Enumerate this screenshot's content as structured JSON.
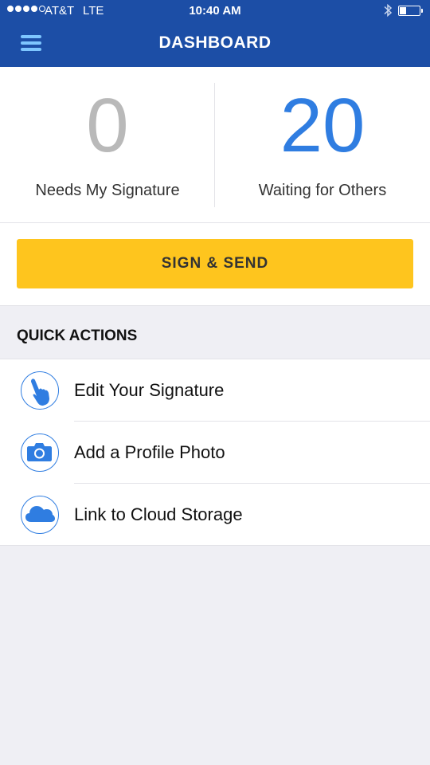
{
  "status": {
    "carrier": "AT&T",
    "network": "LTE",
    "time": "10:40 AM",
    "signal_bars": 4
  },
  "nav": {
    "title": "DASHBOARD"
  },
  "counts": {
    "needs_signature": {
      "value": "0",
      "label": "Needs My Signature"
    },
    "waiting": {
      "value": "20",
      "label": "Waiting for Others"
    }
  },
  "actions": {
    "sign_send_label": "SIGN & SEND"
  },
  "quick_actions": {
    "header": "QUICK ACTIONS",
    "items": [
      {
        "label": "Edit Your Signature",
        "icon": "signature-hand-icon"
      },
      {
        "label": "Add a Profile Photo",
        "icon": "camera-icon"
      },
      {
        "label": "Link to Cloud Storage",
        "icon": "cloud-icon"
      }
    ]
  },
  "colors": {
    "nav_bg": "#1c4ea6",
    "accent_blue": "#2f7de1",
    "button_yellow": "#fec51e",
    "muted_grey": "#b9b9b9"
  }
}
